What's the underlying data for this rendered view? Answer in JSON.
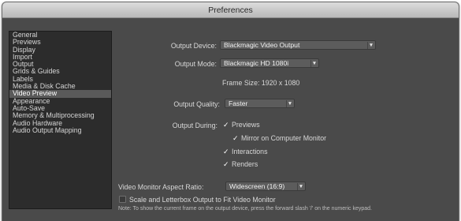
{
  "window": {
    "title": "Preferences"
  },
  "sidebar": {
    "items": [
      {
        "label": "General",
        "selected": false
      },
      {
        "label": "Previews",
        "selected": false
      },
      {
        "label": "Display",
        "selected": false
      },
      {
        "label": "Import",
        "selected": false
      },
      {
        "label": "Output",
        "selected": false
      },
      {
        "label": "Grids & Guides",
        "selected": false
      },
      {
        "label": "Labels",
        "selected": false
      },
      {
        "label": "Media & Disk Cache",
        "selected": false
      },
      {
        "label": "Video Preview",
        "selected": true
      },
      {
        "label": "Appearance",
        "selected": false
      },
      {
        "label": "Auto-Save",
        "selected": false
      },
      {
        "label": "Memory & Multiprocessing",
        "selected": false
      },
      {
        "label": "Audio Hardware",
        "selected": false
      },
      {
        "label": "Audio Output Mapping",
        "selected": false
      }
    ]
  },
  "settings": {
    "output_device": {
      "label": "Output Device:",
      "value": "Blackmagic Video Output"
    },
    "output_mode": {
      "label": "Output Mode:",
      "value": "Blackmagic HD 1080i"
    },
    "frame_size": "Frame Size: 1920 x 1080",
    "output_quality": {
      "label": "Output Quality:",
      "value": "Faster"
    },
    "output_during": {
      "label": "Output During:",
      "previews": {
        "label": "Previews",
        "checked": true
      },
      "mirror": {
        "label": "Mirror on Computer Monitor",
        "checked": true
      },
      "interactions": {
        "label": "Interactions",
        "checked": true
      },
      "renders": {
        "label": "Renders",
        "checked": true
      }
    },
    "aspect_ratio": {
      "label": "Video Monitor Aspect Ratio:",
      "value": "Widescreen (16:9)"
    },
    "scale_letterbox": {
      "label": "Scale and Letterbox Output to Fit Video Monitor",
      "checked": false
    }
  },
  "note": "Note: To show the current frame on the output device, press the forward slash '/' on the numeric keypad.",
  "icons": {
    "dropdown_caret": "chevron-down-icon",
    "check": "checkmark-icon"
  }
}
